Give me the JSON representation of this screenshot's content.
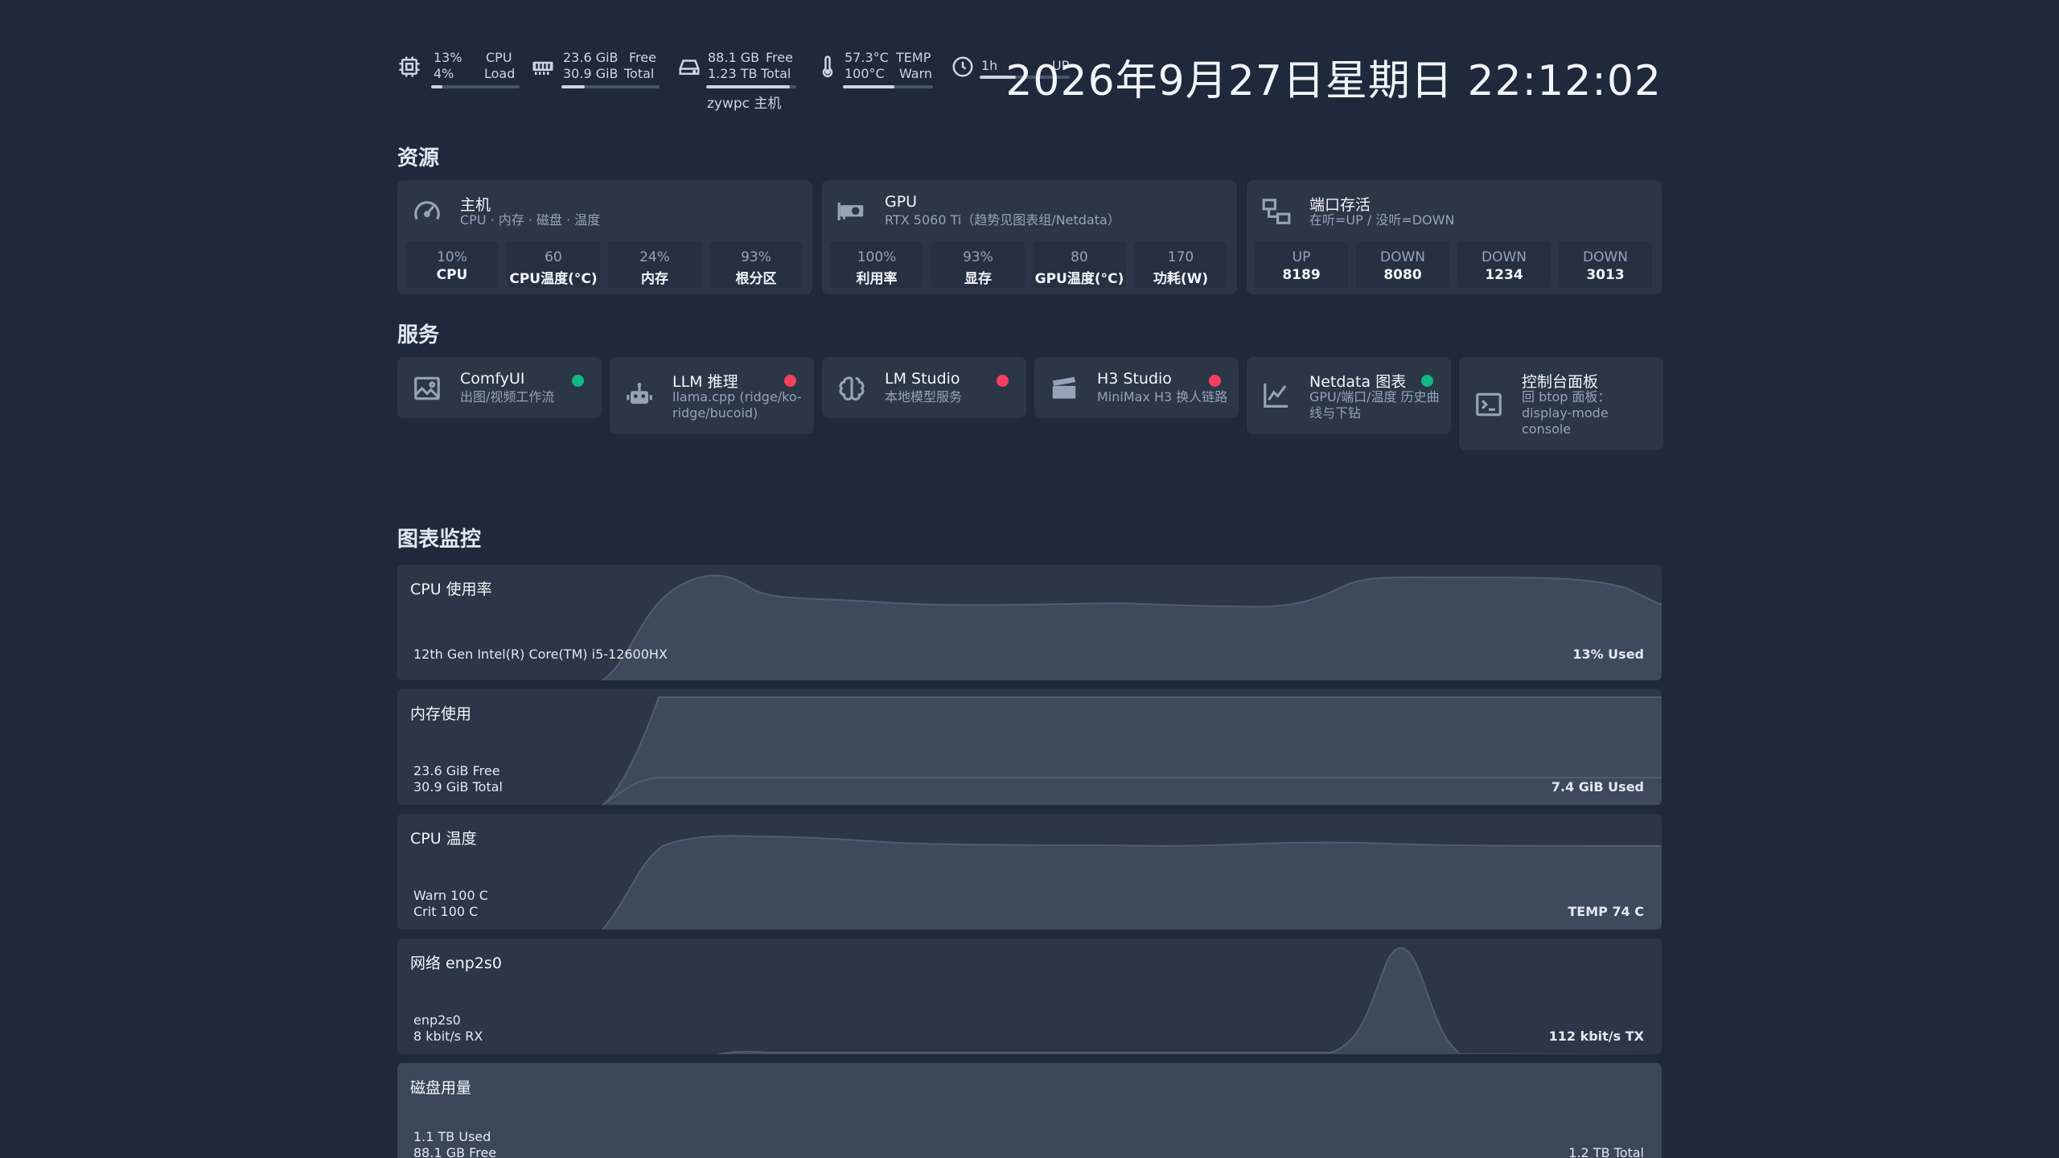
{
  "topbar": {
    "cpu": {
      "line1": "13%",
      "line2": "4%",
      "label1": "CPU",
      "label2": "Load",
      "fill": 0.13
    },
    "mem": {
      "line1": "23.6 GiB",
      "line2": "30.9 GiB",
      "label1": "Free",
      "label2": "Total",
      "fill": 0.24
    },
    "disk": {
      "line1": "88.1 GB",
      "line2": "1.23 TB",
      "label1": "Free",
      "label2": "Total",
      "fill": 0.93
    },
    "temp": {
      "line1": "57.3°C",
      "line2": "100°C",
      "label1": "TEMP",
      "label2": "Warn",
      "fill": 0.57
    },
    "uptime": {
      "line1": "1h",
      "label1": "UP",
      "fill": 0.4
    },
    "host": "zywpc 主机",
    "clock": "2026年9月27日星期日 22:12:02"
  },
  "resources": {
    "title": "资源",
    "host": {
      "title": "主机",
      "sub": "CPU · 内存 · 磁盘 · 温度",
      "metrics": [
        {
          "v": "10%",
          "l": "CPU"
        },
        {
          "v": "60",
          "l": "CPU温度(°C)"
        },
        {
          "v": "24%",
          "l": "内存"
        },
        {
          "v": "93%",
          "l": "根分区"
        }
      ]
    },
    "gpu": {
      "title": "GPU",
      "sub": "RTX 5060 Ti（趋势见图表组/Netdata）",
      "metrics": [
        {
          "v": "100%",
          "l": "利用率"
        },
        {
          "v": "93%",
          "l": "显存"
        },
        {
          "v": "80",
          "l": "GPU温度(°C)"
        },
        {
          "v": "170",
          "l": "功耗(W)"
        }
      ]
    },
    "ports": {
      "title": "端口存活",
      "sub": "在听=UP / 没听=DOWN",
      "metrics": [
        {
          "v": "UP",
          "l": "8189"
        },
        {
          "v": "DOWN",
          "l": "8080"
        },
        {
          "v": "DOWN",
          "l": "1234"
        },
        {
          "v": "DOWN",
          "l": "3013"
        }
      ]
    }
  },
  "services": {
    "title": "服务",
    "items": [
      {
        "title": "ComfyUI",
        "sub": "出图/视频工作流",
        "status": "up"
      },
      {
        "title": "LLM 推理",
        "sub": "llama.cpp (ridge/ko-ridge/bucoid)",
        "status": "down"
      },
      {
        "title": "LM Studio",
        "sub": "本地模型服务",
        "status": "down"
      },
      {
        "title": "H3 Studio",
        "sub": "MiniMax H3 换人链路",
        "status": "down"
      },
      {
        "title": "Netdata 图表",
        "sub": "GPU/端口/温度 历史曲线与下钻",
        "status": "up"
      },
      {
        "title": "控制台面板",
        "sub": "回 btop 面板：display-mode console",
        "status": "none"
      }
    ]
  },
  "charts": {
    "title": "图表监控",
    "cpu": {
      "title": "CPU 使用率",
      "left1": "12th Gen Intel(R) Core(TM) i5-12600HX",
      "right": "13% Used"
    },
    "mem": {
      "title": "内存使用",
      "left1": "23.6 GiB Free",
      "left2": "30.9 GiB Total",
      "right": "7.4 GiB Used"
    },
    "temp": {
      "title": "CPU 温度",
      "left1": "Warn 100 C",
      "left2": "Crit 100 C",
      "right": "TEMP 74 C"
    },
    "net": {
      "title": "网络 enp2s0",
      "left1": "enp2s0",
      "left2": "8 kbit/s RX",
      "right": "112 kbit/s TX"
    },
    "disk": {
      "title": "磁盘用量",
      "left1": "1.1 TB Used",
      "left2": "88.1 GB Free",
      "right": "1.2 TB Total"
    }
  }
}
